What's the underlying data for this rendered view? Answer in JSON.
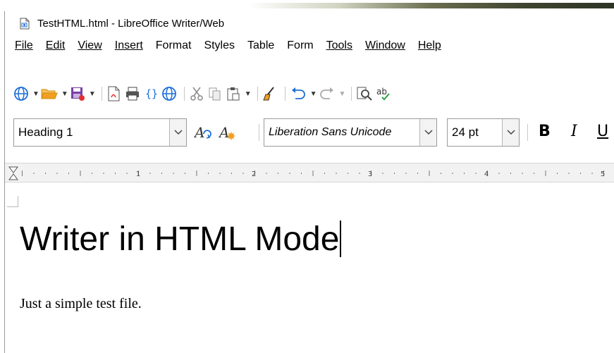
{
  "window": {
    "title": "TestHTML.html - LibreOffice Writer/Web"
  },
  "menubar": {
    "items": [
      {
        "label": "File"
      },
      {
        "label": "Edit"
      },
      {
        "label": "View"
      },
      {
        "label": "Insert"
      },
      {
        "label": "Format"
      },
      {
        "label": "Styles"
      },
      {
        "label": "Table"
      },
      {
        "label": "Form"
      },
      {
        "label": "Tools"
      },
      {
        "label": "Window"
      },
      {
        "label": "Help"
      }
    ]
  },
  "toolbar": {
    "icons": [
      "globe-icon",
      "open-folder-icon",
      "save-icon",
      "export-pdf-icon",
      "print-icon",
      "html-source-icon",
      "web-preview-icon",
      "cut-icon",
      "copy-icon",
      "paste-icon",
      "clone-formatting-icon",
      "undo-icon",
      "redo-icon",
      "find-replace-icon",
      "spelling-icon"
    ]
  },
  "formatting": {
    "paragraph_style": "Heading 1",
    "font_name": "Liberation Sans Unicode",
    "font_size": "24 pt",
    "bold_label": "B",
    "italic_label": "I",
    "underline_label": "U"
  },
  "ruler": {
    "labels": [
      "1",
      "2",
      "3",
      "4",
      "5"
    ]
  },
  "document": {
    "heading": "Writer in HTML Mode",
    "paragraph": "Just a simple test file."
  },
  "colors": {
    "accent_blue": "#1e6fd6",
    "folder_orange": "#f0a020",
    "save_red": "#e03030",
    "save_purple": "#7b3fa8"
  }
}
